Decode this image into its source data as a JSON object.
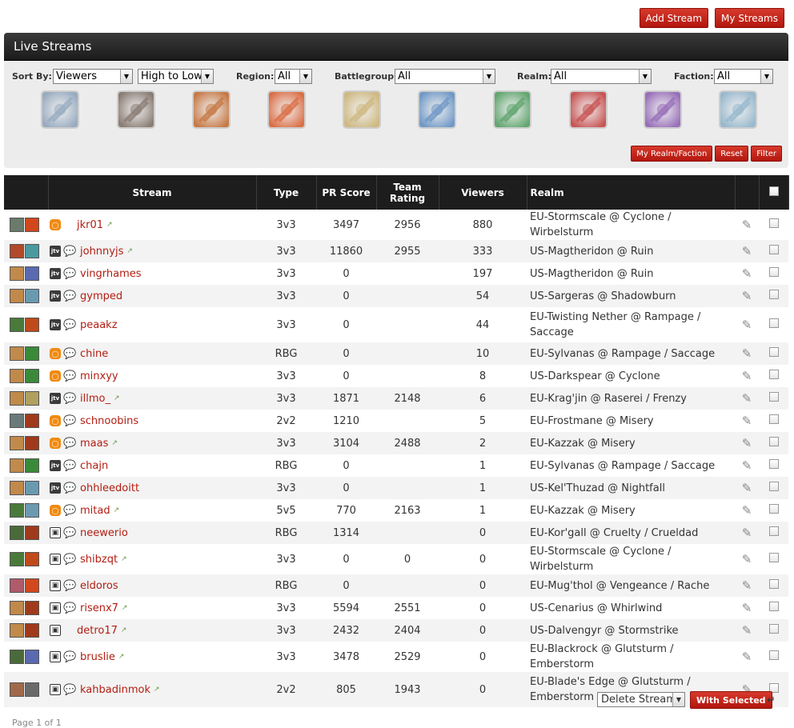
{
  "top_actions": {
    "add_stream": "Add Stream",
    "my_streams": "My Streams"
  },
  "panel": {
    "title": "Live Streams",
    "filters": {
      "sort_by_label": "Sort By:",
      "sort_by_value": "Viewers",
      "order_value": "High to Low",
      "region_label": "Region:",
      "region_value": "All",
      "battlegroup_label": "Battlegroup:",
      "battlegroup_value": "All",
      "realm_label": "Realm:",
      "realm_value": "All",
      "faction_label": "Faction:",
      "faction_value": "All"
    },
    "class_icons": [
      {
        "name": "priest-class-icon",
        "color": "#8aa0b8"
      },
      {
        "name": "rogue-class-icon",
        "color": "#7a6a60"
      },
      {
        "name": "hunter-class-icon",
        "color": "#c0662a"
      },
      {
        "name": "mage-class-icon",
        "color": "#d85a2a"
      },
      {
        "name": "paladin-class-icon",
        "color": "#c9b070"
      },
      {
        "name": "shaman-class-icon",
        "color": "#5a8ac0"
      },
      {
        "name": "druid-class-icon",
        "color": "#4a9a5a"
      },
      {
        "name": "warlock-class-icon",
        "color": "#c23a3a"
      },
      {
        "name": "deathknight-class-icon",
        "color": "#8a5ab0"
      },
      {
        "name": "warrior-class-icon",
        "color": "#8ab0c8"
      }
    ],
    "buttons": {
      "my_realm_faction": "My Realm/Faction",
      "reset": "Reset",
      "filter": "Filter"
    }
  },
  "table": {
    "headers": {
      "stream": "Stream",
      "type": "Type",
      "pr_score": "PR Score",
      "team_rating": "Team Rating",
      "viewers": "Viewers",
      "realm": "Realm"
    },
    "rows": [
      {
        "name": "jkr01",
        "platform": "own",
        "chat": false,
        "ext": true,
        "type": "3v3",
        "pr_score": "3497",
        "team_rating": "2956",
        "viewers": "880",
        "realm": "EU-Stormscale @ Cyclone / Wirbelsturm",
        "av1": "#6b7a6a",
        "av2": "#d2471c",
        "tall": false
      },
      {
        "name": "johnnyjs",
        "platform": "jtv",
        "chat": true,
        "ext": true,
        "type": "3v3",
        "pr_score": "11860",
        "team_rating": "2955",
        "viewers": "333",
        "realm": "US-Magtheridon @ Ruin",
        "av1": "#b04a2a",
        "av2": "#4a9aa0",
        "tall": false
      },
      {
        "name": "vingrhames",
        "platform": "jtv",
        "chat": true,
        "ext": false,
        "type": "3v3",
        "pr_score": "0",
        "team_rating": "",
        "viewers": "197",
        "realm": "US-Magtheridon @ Ruin",
        "av1": "#c08a4a",
        "av2": "#5a6ab0",
        "tall": false
      },
      {
        "name": "gymped",
        "platform": "jtv",
        "chat": true,
        "ext": false,
        "type": "3v3",
        "pr_score": "0",
        "team_rating": "",
        "viewers": "54",
        "realm": "US-Sargeras @ Shadowburn",
        "av1": "#c08a4a",
        "av2": "#6a9ab0",
        "tall": false
      },
      {
        "name": "peaakz",
        "platform": "jtv",
        "chat": true,
        "ext": false,
        "type": "3v3",
        "pr_score": "0",
        "team_rating": "",
        "viewers": "44",
        "realm": "EU-Twisting Nether @ Rampage / Saccage",
        "av1": "#4a7a3a",
        "av2": "#c04a1a",
        "tall": true
      },
      {
        "name": "chine",
        "platform": "own",
        "chat": true,
        "ext": false,
        "type": "RBG",
        "pr_score": "0",
        "team_rating": "",
        "viewers": "10",
        "realm": "EU-Sylvanas @ Rampage / Saccage",
        "av1": "#c08a4a",
        "av2": "#3a8a3a",
        "tall": false
      },
      {
        "name": "minxyy",
        "platform": "own",
        "chat": true,
        "ext": false,
        "type": "3v3",
        "pr_score": "0",
        "team_rating": "",
        "viewers": "8",
        "realm": "US-Darkspear @ Cyclone",
        "av1": "#c08a4a",
        "av2": "#3a8a3a",
        "tall": false
      },
      {
        "name": "illmo_",
        "platform": "jtv",
        "chat": true,
        "ext": true,
        "type": "3v3",
        "pr_score": "1871",
        "team_rating": "2148",
        "viewers": "6",
        "realm": "EU-Krag'jin @ Raserei / Frenzy",
        "av1": "#c08a4a",
        "av2": "#b0a060",
        "tall": false
      },
      {
        "name": "schnoobins",
        "platform": "own",
        "chat": true,
        "ext": false,
        "type": "2v2",
        "pr_score": "1210",
        "team_rating": "",
        "viewers": "5",
        "realm": "EU-Frostmane @ Misery",
        "av1": "#6a7a7a",
        "av2": "#a03a1a",
        "tall": false
      },
      {
        "name": "maas",
        "platform": "own",
        "chat": true,
        "ext": true,
        "type": "3v3",
        "pr_score": "3104",
        "team_rating": "2488",
        "viewers": "2",
        "realm": "EU-Kazzak @ Misery",
        "av1": "#c08a4a",
        "av2": "#a03a1a",
        "tall": false
      },
      {
        "name": "chajn",
        "platform": "jtv",
        "chat": true,
        "ext": false,
        "type": "RBG",
        "pr_score": "0",
        "team_rating": "",
        "viewers": "1",
        "realm": "EU-Sylvanas @ Rampage / Saccage",
        "av1": "#c08a4a",
        "av2": "#3a8a3a",
        "tall": false
      },
      {
        "name": "ohhleedoitt",
        "platform": "jtv",
        "chat": true,
        "ext": false,
        "type": "3v3",
        "pr_score": "0",
        "team_rating": "",
        "viewers": "1",
        "realm": "US-Kel'Thuzad @ Nightfall",
        "av1": "#c08a4a",
        "av2": "#6a9ab0",
        "tall": false
      },
      {
        "name": "mitad",
        "platform": "own",
        "chat": true,
        "ext": true,
        "type": "5v5",
        "pr_score": "770",
        "team_rating": "2163",
        "viewers": "1",
        "realm": "EU-Kazzak @ Misery",
        "av1": "#4a7a3a",
        "av2": "#6a9ab0",
        "tall": false
      },
      {
        "name": "neewerio",
        "platform": "ust",
        "chat": true,
        "ext": false,
        "type": "RBG",
        "pr_score": "1314",
        "team_rating": "",
        "viewers": "0",
        "realm": "EU-Kor'gall @ Cruelty / Crueldad",
        "av1": "#4a6a3a",
        "av2": "#a03a1a",
        "tall": false
      },
      {
        "name": "shibzqt",
        "platform": "ust",
        "chat": true,
        "ext": true,
        "type": "3v3",
        "pr_score": "0",
        "team_rating": "0",
        "viewers": "0",
        "realm": "EU-Stormscale @ Cyclone / Wirbelsturm",
        "av1": "#4a7a3a",
        "av2": "#c04a1a",
        "tall": false
      },
      {
        "name": "eldoros",
        "platform": "ust",
        "chat": true,
        "ext": false,
        "type": "RBG",
        "pr_score": "0",
        "team_rating": "",
        "viewers": "0",
        "realm": "EU-Mug'thol @ Vengeance / Rache",
        "av1": "#b05a6a",
        "av2": "#d2471c",
        "tall": false
      },
      {
        "name": "risenx7",
        "platform": "ust",
        "chat": true,
        "ext": true,
        "type": "3v3",
        "pr_score": "5594",
        "team_rating": "2551",
        "viewers": "0",
        "realm": "US-Cenarius @ Whirlwind",
        "av1": "#c08a4a",
        "av2": "#a03a1a",
        "tall": false
      },
      {
        "name": "detro17",
        "platform": "ust",
        "chat": false,
        "ext": true,
        "type": "3v3",
        "pr_score": "2432",
        "team_rating": "2404",
        "viewers": "0",
        "realm": "US-Dalvengyr @ Stormstrike",
        "av1": "#c08a4a",
        "av2": "#a03a1a",
        "tall": false
      },
      {
        "name": "bruslie",
        "platform": "ust",
        "chat": true,
        "ext": true,
        "type": "3v3",
        "pr_score": "3478",
        "team_rating": "2529",
        "viewers": "0",
        "realm": "EU-Blackrock @ Glutsturm / Emberstorm",
        "av1": "#4a6a3a",
        "av2": "#5a6ab0",
        "tall": false
      },
      {
        "name": "kahbadinmok",
        "platform": "ust",
        "chat": true,
        "ext": true,
        "type": "2v2",
        "pr_score": "805",
        "team_rating": "1943",
        "viewers": "0",
        "realm": "EU-Blade's Edge @ Glutsturm / Emberstorm",
        "av1": "#a06a4a",
        "av2": "#6a6a6a",
        "tall": true
      }
    ]
  },
  "bulk": {
    "action_value": "Delete Stream",
    "with_selected": "With Selected"
  },
  "pagination": {
    "text": "Page 1 of 1"
  },
  "colors": {
    "accent_red": "#c3271b",
    "header_dark": "#1d1d1d",
    "link_red": "#b21e12"
  }
}
